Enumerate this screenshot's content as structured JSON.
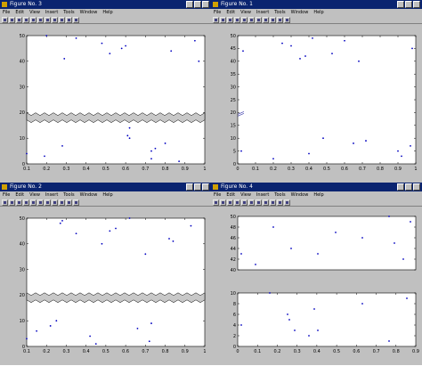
{
  "menu": [
    "File",
    "Edit",
    "View",
    "Insert",
    "Tools",
    "Window",
    "Help"
  ],
  "windows": [
    {
      "title": "Figure No. 3",
      "axes": [
        {
          "xlim": [
            0.1,
            1
          ],
          "ylim": [
            0,
            50
          ],
          "xticks": [
            "0.1",
            "0.2",
            "0.3",
            "0.4",
            "0.5",
            "0.6",
            "0.7",
            "0.8",
            "0.9",
            "1"
          ],
          "yticks": [
            "0",
            "10",
            "20",
            "30",
            "40",
            "50"
          ],
          "break": {
            "y": 18,
            "band": 2
          },
          "points": [
            [
              0.1,
              4
            ],
            [
              0.19,
              3
            ],
            [
              0.2,
              50
            ],
            [
              0.28,
              7
            ],
            [
              0.29,
              41
            ],
            [
              0.35,
              49
            ],
            [
              0.48,
              47
            ],
            [
              0.52,
              43
            ],
            [
              0.58,
              45
            ],
            [
              0.6,
              46
            ],
            [
              0.61,
              11
            ],
            [
              0.62,
              10
            ],
            [
              0.62,
              14
            ],
            [
              0.73,
              5
            ],
            [
              0.75,
              6
            ],
            [
              0.8,
              8
            ],
            [
              0.83,
              44
            ],
            [
              0.87,
              1
            ],
            [
              0.95,
              48
            ],
            [
              0.97,
              40
            ],
            [
              0.73,
              2
            ]
          ]
        }
      ]
    },
    {
      "title": "Figure No. 1",
      "axes": [
        {
          "xlim": [
            0,
            1
          ],
          "ylim": [
            0,
            50
          ],
          "xticks": [
            "0",
            "0.1",
            "0.2",
            "0.3",
            "0.4",
            "0.5",
            "0.6",
            "0.7",
            "0.8",
            "0.9",
            "1"
          ],
          "yticks": [
            "0",
            "5",
            "10",
            "15",
            "20",
            "25",
            "30",
            "35",
            "40",
            "45",
            "50"
          ],
          "break": {
            "y": 20,
            "band": 1,
            "stub_only": true
          },
          "points": [
            [
              0.02,
              5
            ],
            [
              0.03,
              44
            ],
            [
              0.2,
              2
            ],
            [
              0.25,
              47
            ],
            [
              0.3,
              46
            ],
            [
              0.35,
              41
            ],
            [
              0.38,
              42
            ],
            [
              0.4,
              4
            ],
            [
              0.42,
              49
            ],
            [
              0.48,
              10
            ],
            [
              0.53,
              43
            ],
            [
              0.6,
              48
            ],
            [
              0.65,
              8
            ],
            [
              0.68,
              40
            ],
            [
              0.72,
              9
            ],
            [
              0.9,
              5
            ],
            [
              0.92,
              3
            ],
            [
              0.97,
              7
            ],
            [
              0.98,
              45
            ]
          ]
        }
      ]
    },
    {
      "title": "Figure No. 2",
      "axes": [
        {
          "xlim": [
            0.1,
            1
          ],
          "ylim": [
            0,
            50
          ],
          "xticks": [
            "0.1",
            "0.2",
            "0.3",
            "0.4",
            "0.5",
            "0.6",
            "0.7",
            "0.8",
            "0.9",
            "1"
          ],
          "yticks": [
            "0",
            "10",
            "20",
            "30",
            "40",
            "50"
          ],
          "break": {
            "y": 19,
            "band": 2
          },
          "points": [
            [
              0.1,
              3
            ],
            [
              0.15,
              6
            ],
            [
              0.22,
              8
            ],
            [
              0.25,
              10
            ],
            [
              0.27,
              48
            ],
            [
              0.28,
              49
            ],
            [
              0.35,
              44
            ],
            [
              0.42,
              4
            ],
            [
              0.45,
              1
            ],
            [
              0.48,
              40
            ],
            [
              0.52,
              45
            ],
            [
              0.55,
              46
            ],
            [
              0.62,
              50
            ],
            [
              0.66,
              7
            ],
            [
              0.7,
              36
            ],
            [
              0.72,
              2
            ],
            [
              0.73,
              9
            ],
            [
              0.82,
              42
            ],
            [
              0.84,
              41
            ],
            [
              0.93,
              47
            ]
          ]
        }
      ]
    },
    {
      "title": "Figure No. 4",
      "axes": [
        {
          "xlim": [
            0,
            1
          ],
          "ylim": [
            40,
            50
          ],
          "xticks": [],
          "yticks": [
            "40",
            "42",
            "44",
            "46",
            "48",
            "50"
          ],
          "points": [
            [
              0.02,
              43
            ],
            [
              0.1,
              41
            ],
            [
              0.2,
              48
            ],
            [
              0.3,
              44
            ],
            [
              0.45,
              43
            ],
            [
              0.55,
              47
            ],
            [
              0.7,
              46
            ],
            [
              0.85,
              50
            ],
            [
              0.88,
              45
            ],
            [
              0.93,
              42
            ],
            [
              0.97,
              49
            ]
          ]
        },
        {
          "xlim": [
            0,
            1
          ],
          "ylim": [
            0,
            10
          ],
          "xticks": [
            "0",
            "0.1",
            "0.2",
            "0.3",
            "0.4",
            "0.5",
            "0.6",
            "0.7",
            "0.8",
            "0.9"
          ],
          "yticks": [
            "0",
            "2",
            "4",
            "6",
            "8",
            "10"
          ],
          "points": [
            [
              0.02,
              4
            ],
            [
              0.18,
              10
            ],
            [
              0.28,
              6
            ],
            [
              0.29,
              5
            ],
            [
              0.32,
              3
            ],
            [
              0.4,
              2
            ],
            [
              0.43,
              7
            ],
            [
              0.45,
              3
            ],
            [
              0.7,
              8
            ],
            [
              0.85,
              1
            ],
            [
              0.95,
              9
            ]
          ]
        }
      ]
    }
  ]
}
